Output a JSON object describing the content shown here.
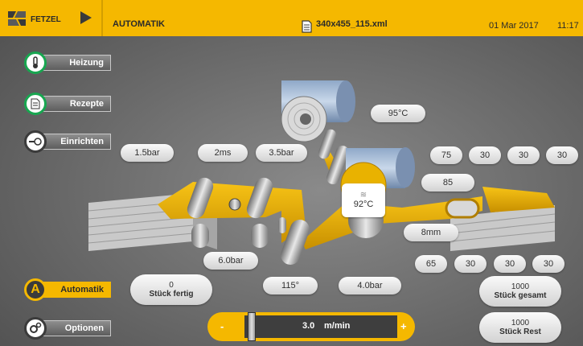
{
  "header": {
    "logo_text": "FETZEL",
    "mode": "AUTOMATIK",
    "file": "340x455_115.xml",
    "date": "01 Mar 2017",
    "time": "11:17"
  },
  "sidebar": {
    "heizung": "Heizung",
    "rezepte": "Rezepte",
    "einrichten": "Einrichten",
    "automatik": "Automatik",
    "automatik_icon_letter": "A",
    "optionen": "Optionen"
  },
  "machine": {
    "temp_top": "95°C",
    "temp_roller": "92°C",
    "pressure_1": "1.5bar",
    "time_1": "2ms",
    "pressure_2": "3.5bar",
    "pressure_3": "6.0bar",
    "angle": "115°",
    "pressure_4": "4.0bar",
    "gap": "8mm",
    "v85": "85",
    "top_row": [
      "75",
      "30",
      "30",
      "30"
    ],
    "bottom_row": [
      "65",
      "30",
      "30",
      "30"
    ]
  },
  "counters": {
    "fertig_value": "0",
    "fertig_label": "Stück fertig",
    "gesamt_value": "1000",
    "gesamt_label": "Stück gesamt",
    "rest_value": "1000",
    "rest_label": "Stück Rest"
  },
  "speed": {
    "minus": "-",
    "plus": "+",
    "value": "3.0",
    "unit": "m/min",
    "level_fraction": 0.0
  },
  "colors": {
    "accent": "#f5b800",
    "header_text": "#2a2a2a",
    "green": "#18a650"
  }
}
